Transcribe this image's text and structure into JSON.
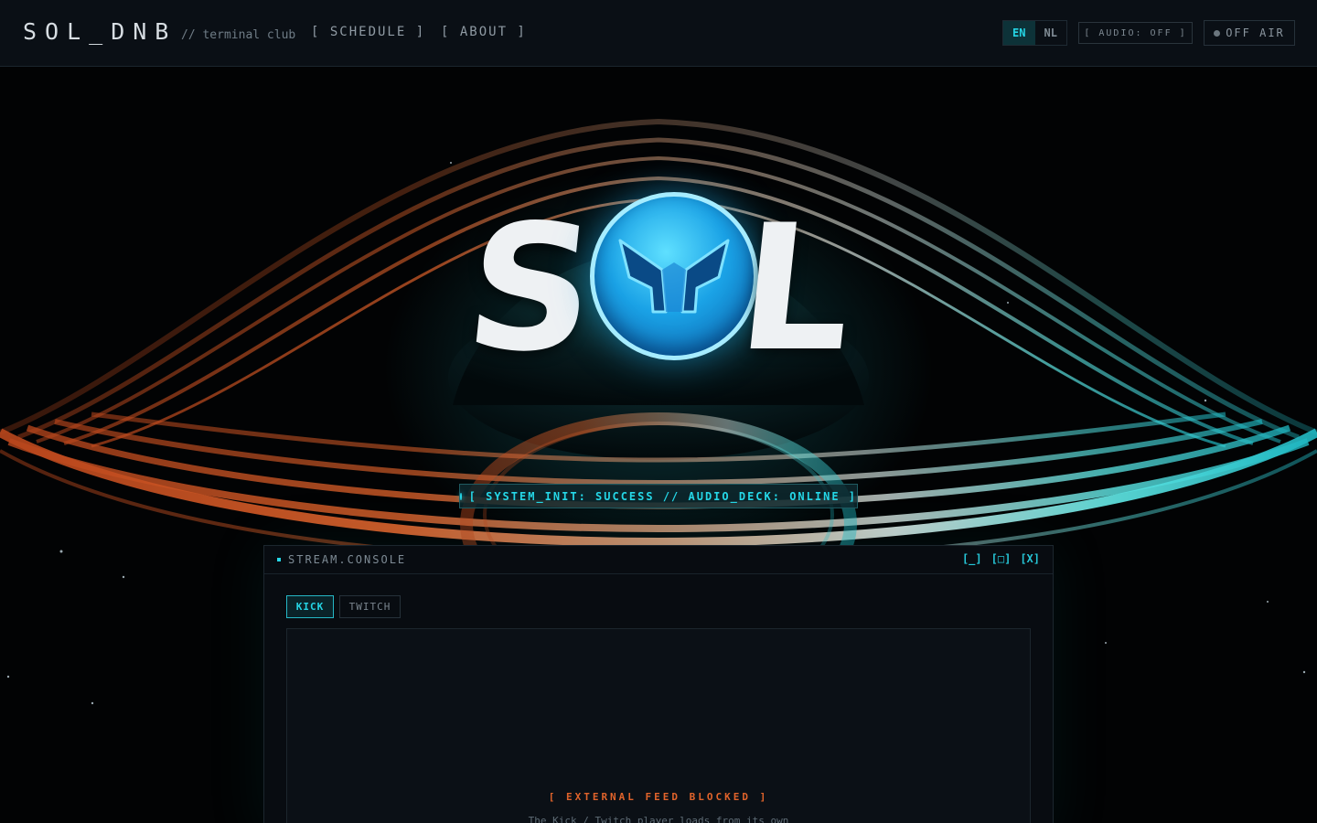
{
  "header": {
    "brand": "SOL_DNB",
    "tagline": "// terminal club",
    "nav": {
      "schedule": "[ SCHEDULE ]",
      "about": "[ ABOUT ]"
    },
    "lang": {
      "en": "EN",
      "nl": "NL",
      "active": "EN"
    },
    "audio_toggle": "[ AUDIO: OFF ]",
    "status": "OFF AIR"
  },
  "hero": {
    "logo": {
      "s": "S",
      "l": "L"
    },
    "system_status": "[ SYSTEM_INIT: SUCCESS // AUDIO_DECK: ONLINE ]"
  },
  "console": {
    "title": "STREAM.CONSOLE",
    "controls": {
      "minimize": "[_]",
      "maximize": "[□]",
      "close": "[X]"
    },
    "tabs": [
      {
        "label": "KICK",
        "active": true
      },
      {
        "label": "TWITCH",
        "active": false
      }
    ],
    "player": {
      "blocked_title": "[ EXTERNAL FEED BLOCKED ]",
      "blocked_message": "The Kick / Twitch player loads from its own"
    }
  },
  "colors": {
    "accent": "#25d4e4",
    "warning": "#e0632b",
    "ring_warm": "#e0632b",
    "ring_cool": "#7ff0ee"
  }
}
